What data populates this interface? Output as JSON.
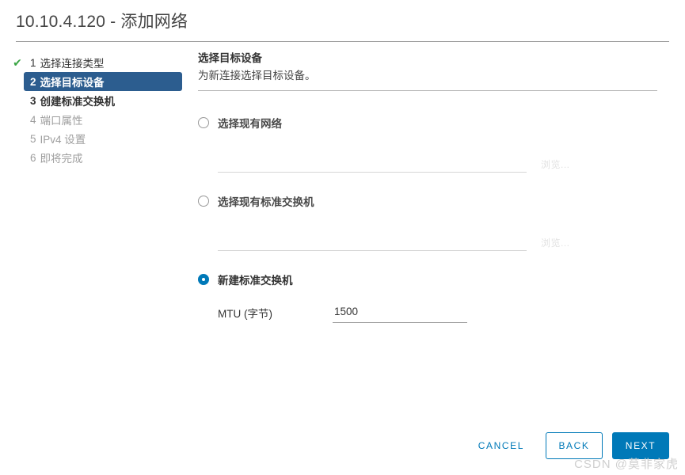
{
  "header": {
    "title": "10.10.4.120 - 添加网络"
  },
  "sidebar": {
    "steps": [
      {
        "num": "1",
        "label": "选择连接类型",
        "state": "done",
        "check": "✔"
      },
      {
        "num": "2",
        "label": "选择目标设备",
        "state": "current"
      },
      {
        "num": "3",
        "label": "创建标准交换机",
        "state": "next"
      },
      {
        "num": "4",
        "label": "端口属性",
        "state": "disabled"
      },
      {
        "num": "5",
        "label": "IPv4 设置",
        "state": "disabled"
      },
      {
        "num": "6",
        "label": "即将完成",
        "state": "disabled"
      }
    ]
  },
  "content": {
    "title": "选择目标设备",
    "subtitle": "为新连接选择目标设备。",
    "options": [
      {
        "label": "选择现有网络",
        "selected": false,
        "input_value": "",
        "browse_label": "浏览..."
      },
      {
        "label": "选择现有标准交换机",
        "selected": false,
        "input_value": "",
        "browse_label": "浏览..."
      },
      {
        "label": "新建标准交换机",
        "selected": true
      }
    ],
    "mtu": {
      "label": "MTU (字节)",
      "value": "1500"
    }
  },
  "footer": {
    "cancel_label": "CANCEL",
    "back_label": "BACK",
    "next_label": "NEXT"
  },
  "watermark": {
    "text": "CSDN @莫非家虎"
  },
  "colors": {
    "accent": "#0079b8",
    "step_current_bg": "#2c5d8f",
    "check_green": "#3aa544",
    "text": "#333333",
    "text_disabled": "#9e9e9e"
  }
}
